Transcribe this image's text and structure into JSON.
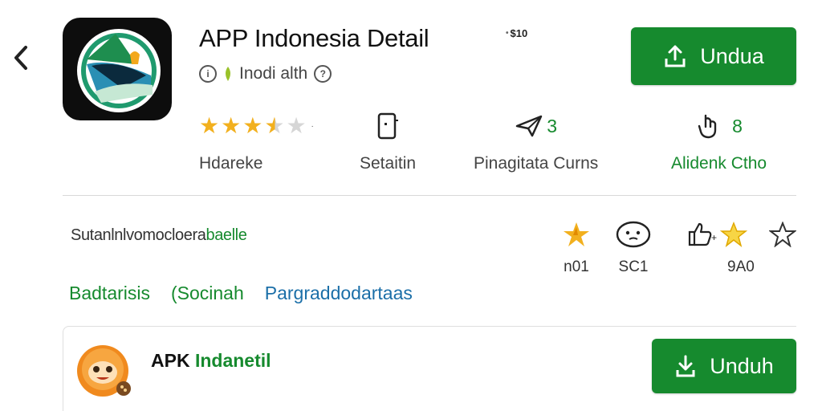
{
  "header": {
    "title": "APP Indonesia Detail",
    "price_tag": "$10",
    "subtitle": "Inodi alth",
    "download_label": "Undua"
  },
  "stats": [
    {
      "label": "Hdareke",
      "value": "",
      "rating": 3.5
    },
    {
      "label": "Setaitin",
      "value": ""
    },
    {
      "label": "Pinagitata Curns",
      "value": "3"
    },
    {
      "label": "Alidenk Ctho",
      "value": "8"
    }
  ],
  "description": {
    "text": "Sutanlnlvomocloera",
    "highlight": "baelle"
  },
  "mini_stats": [
    {
      "value": "n01"
    },
    {
      "value": "SC1"
    },
    {
      "value": "9A0"
    },
    {
      "value": ""
    }
  ],
  "tags": [
    "Badtarisis",
    "(Socinah",
    "Pargraddodartaas"
  ],
  "card": {
    "title_prefix": "APK",
    "title_highlight": "Indanetil",
    "download_label": "Unduh"
  },
  "colors": {
    "accent_green": "#168a2e",
    "link_blue": "#1b6fa8",
    "star_gold": "#f2b01e"
  }
}
